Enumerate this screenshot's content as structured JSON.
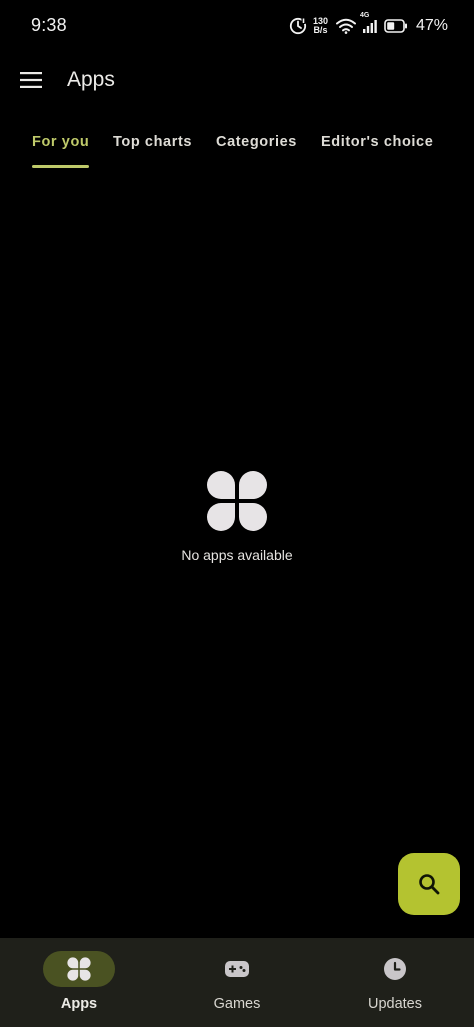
{
  "status_bar": {
    "time": "9:38",
    "net_speed_value": "130",
    "net_speed_unit": "B/s",
    "network_type": "4G",
    "battery_percent": "47%"
  },
  "app_bar": {
    "title": "Apps",
    "menu_icon": "hamburger-menu-icon"
  },
  "tabs": [
    {
      "label": "For you",
      "active": true
    },
    {
      "label": "Top charts",
      "active": false
    },
    {
      "label": "Categories",
      "active": false
    },
    {
      "label": "Editor's choice",
      "active": false
    }
  ],
  "empty_state": {
    "icon": "apps-grid-icon",
    "message": "No apps available"
  },
  "fab": {
    "icon": "search-icon"
  },
  "bottom_nav": [
    {
      "label": "Apps",
      "icon": "apps-grid-icon",
      "active": true
    },
    {
      "label": "Games",
      "icon": "gamepad-icon",
      "active": false
    },
    {
      "label": "Updates",
      "icon": "clock-icon",
      "active": false
    }
  ],
  "colors": {
    "background": "#000000",
    "accent": "#bfca6a",
    "fab": "#b4c330",
    "nav_background": "#1f201a",
    "nav_active_pill": "#4a5222"
  }
}
